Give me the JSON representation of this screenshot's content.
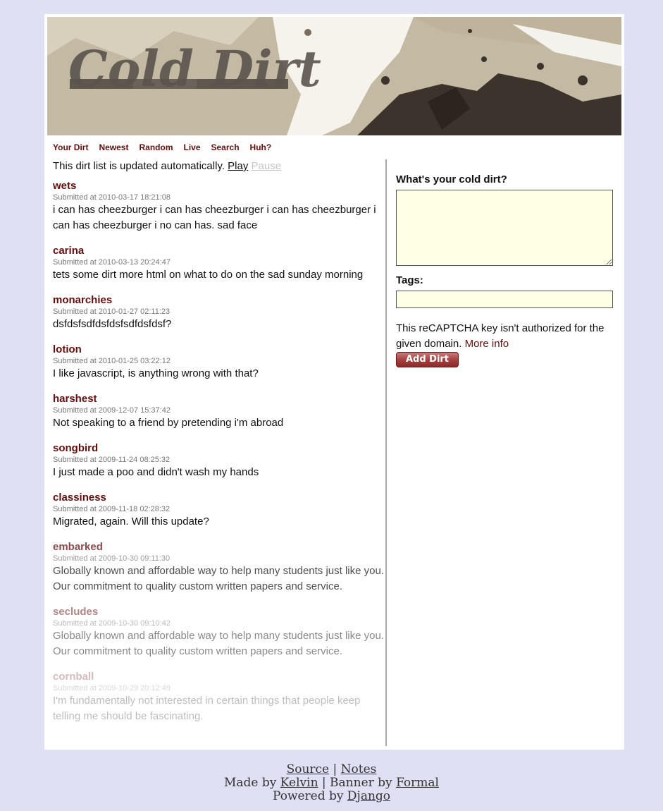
{
  "banner": {
    "logo_text": "Cold Dirt"
  },
  "nav": {
    "items": [
      {
        "label": "Your Dirt"
      },
      {
        "label": "Newest"
      },
      {
        "label": "Random"
      },
      {
        "label": "Live"
      },
      {
        "label": "Search"
      },
      {
        "label": "Huh?"
      }
    ]
  },
  "status": {
    "text": "This dirt list is updated automatically.",
    "play": "Play",
    "pause": "Pause"
  },
  "entries": [
    {
      "title": "wets",
      "meta": "Submitted at 2010-03-17 18:21:08",
      "body": "i can has cheezburger i can has cheezburger i can has cheezburger i can has cheezburger i no can has. sad face",
      "opacity": 1
    },
    {
      "title": "carina",
      "meta": "Submitted at 2010-03-13 20:24:47",
      "body": "tets some dirt more html on what to do on the sad sunday morning",
      "opacity": 1
    },
    {
      "title": "monarchies",
      "meta": "Submitted at 2010-01-27 02:11:23",
      "body": "dsfdsfsdfdsfdsfsdfdsfdsf?",
      "opacity": 1
    },
    {
      "title": "lotion",
      "meta": "Submitted at 2010-01-25 03:22:12",
      "body": "I like javascript, is anything wrong with that?",
      "opacity": 1
    },
    {
      "title": "harshest",
      "meta": "Submitted at 2009-12-07 15:37:42",
      "body": "Not speaking to a friend by pretending i'm abroad",
      "opacity": 1
    },
    {
      "title": "songbird",
      "meta": "Submitted at 2009-11-24 08:25:32",
      "body": "I just made a poo and didn't wash my hands",
      "opacity": 1
    },
    {
      "title": "classiness",
      "meta": "Submitted at 2009-11-18 02:28:32",
      "body": "Migrated, again. Will this update?",
      "opacity": 1
    },
    {
      "title": "embarked",
      "meta": "Submitted at 2009-10-30 09:11:30",
      "body": "Globally known and affordable way to help many students just like you. Our commitment to quality custom written papers and service.",
      "opacity": 0.75
    },
    {
      "title": "secludes",
      "meta": "Submitted at 2009-10-30 09:10:42",
      "body": "Globally known and affordable way to help many students just like you. Our commitment to quality custom written papers and service.",
      "opacity": 0.5
    },
    {
      "title": "cornball",
      "meta": "Submitted at 2009-10-29 20:12:49",
      "body": "I'm fundamentally not interested in certain things that people keep telling me should be fascinating.",
      "opacity": 0.28
    }
  ],
  "form": {
    "dirt_label": "What's your cold dirt?",
    "dirt_value": "",
    "tags_label": "Tags:",
    "tags_value": "",
    "captcha_text": "This reCAPTCHA key isn't authorized for the given domain.",
    "captcha_link": "More info",
    "submit_label": "Add Dirt"
  },
  "footer": {
    "source": "Source",
    "sep1": "|",
    "notes": "Notes",
    "made_by": "Made by",
    "kelvin": "Kelvin",
    "banner_by": "| Banner by",
    "formal": "Formal",
    "powered_by": "Powered by",
    "django": "Django"
  },
  "colors": {
    "page_bg": "#e0e0f4",
    "link": "#6a0a0a",
    "field_bg": "#ffffe6"
  }
}
